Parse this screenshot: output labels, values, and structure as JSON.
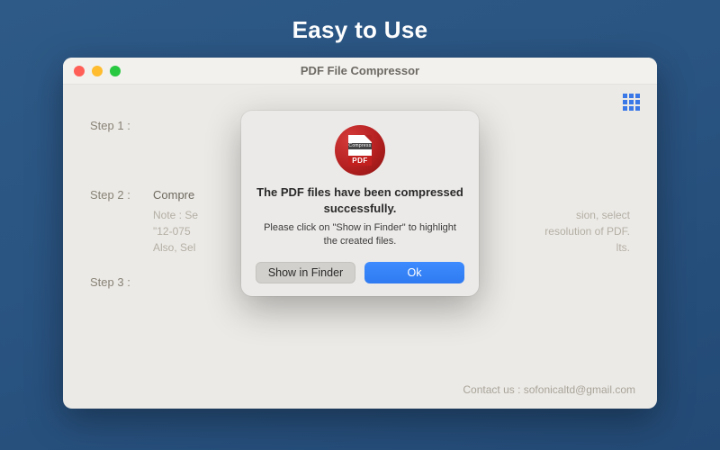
{
  "hero": {
    "title": "Easy to Use"
  },
  "window": {
    "title": "PDF File Compressor",
    "steps": {
      "s1_label": "Step 1 :",
      "s2_label": "Step 2 :",
      "s2_heading": "Compre",
      "s2_note_line1": "Note : Se",
      "s2_note_line1_right": "sion, select",
      "s2_note_line2": "\"12-075",
      "s2_note_line2_right": "resolution of PDF.",
      "s2_note_line3": "Also, Sel",
      "s2_note_line3_right": "lts.",
      "s3_label": "Step 3 :"
    },
    "contact": "Contact us : sofonicaltd@gmail.com"
  },
  "modal": {
    "icon": {
      "compress_label": "Compress",
      "pdf_label": "PDF"
    },
    "heading": "The PDF files have been compressed successfully.",
    "subtext": "Please click on \"Show in Finder\" to highlight the created files.",
    "buttons": {
      "show_in_finder": "Show in Finder",
      "ok": "Ok"
    }
  }
}
